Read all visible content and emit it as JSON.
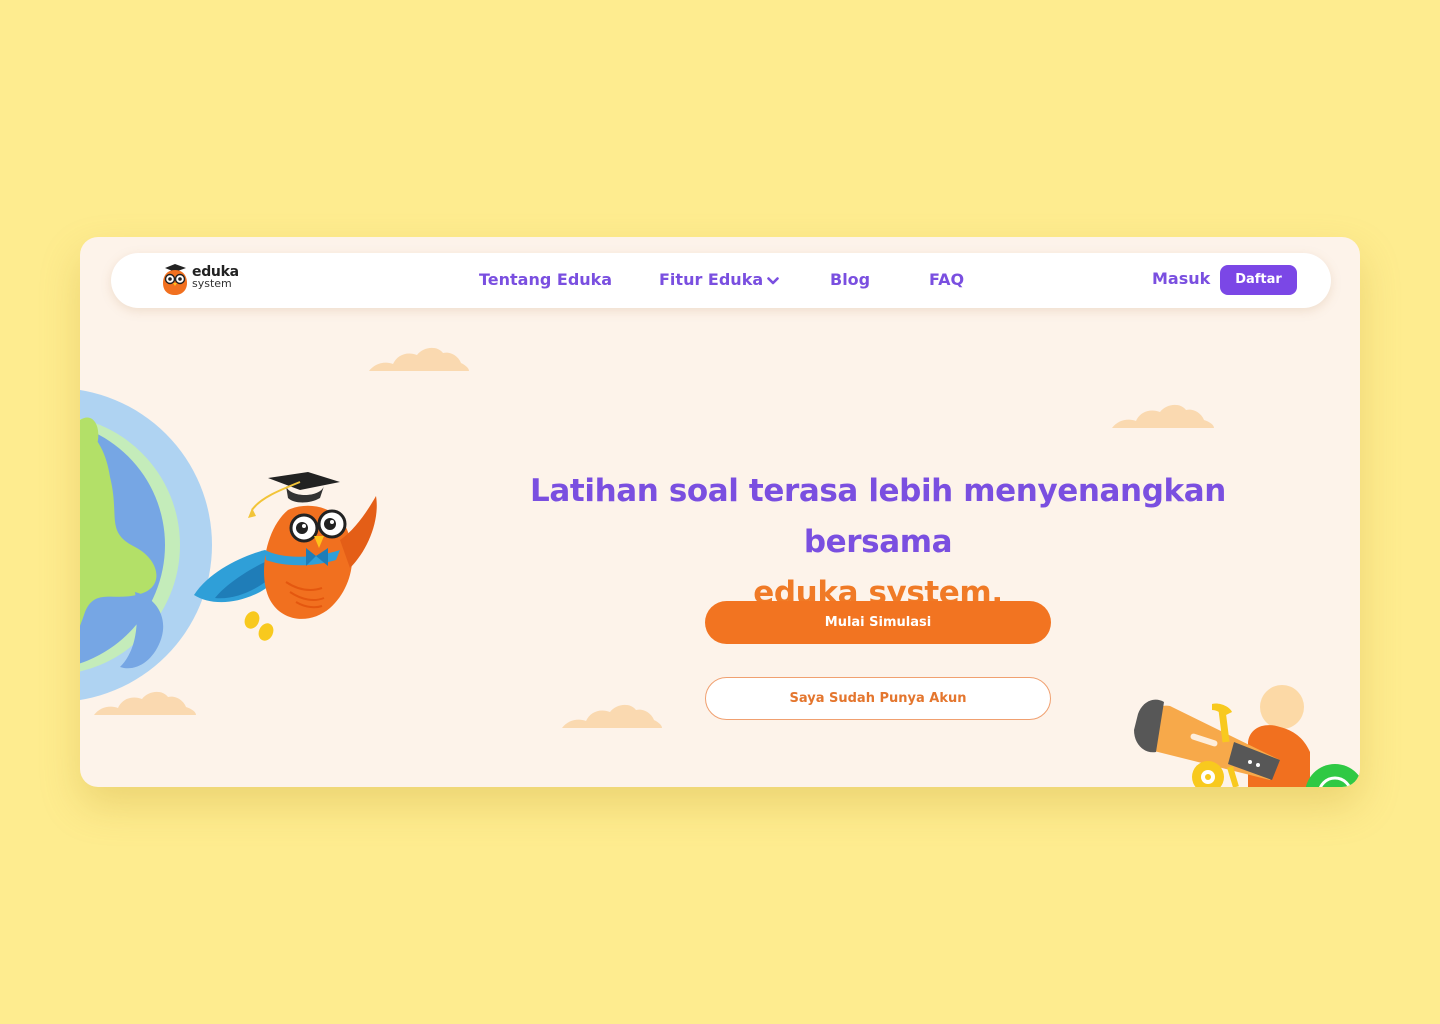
{
  "brand": {
    "name_line1": "eduka",
    "name_line2": "system"
  },
  "nav": {
    "links": [
      {
        "label": "Tentang Eduka"
      },
      {
        "label": "Fitur Eduka",
        "has_dropdown": true
      },
      {
        "label": "Blog"
      },
      {
        "label": "FAQ"
      }
    ],
    "login_label": "Masuk",
    "register_label": "Daftar"
  },
  "hero": {
    "headline_part1": "Latihan soal terasa lebih menyenangkan bersama",
    "headline_part2": "eduka system.",
    "primary_cta": "Mulai Simulasi",
    "secondary_cta": "Saya Sudah Punya Akun"
  },
  "colors": {
    "page_background": "#FEEC8F",
    "card_background": "#FDF3EA",
    "purple": "#7A4FE0",
    "orange": "#F27421"
  },
  "icons": [
    "owl-logo-icon",
    "chevron-down-icon",
    "whatsapp-icon"
  ]
}
